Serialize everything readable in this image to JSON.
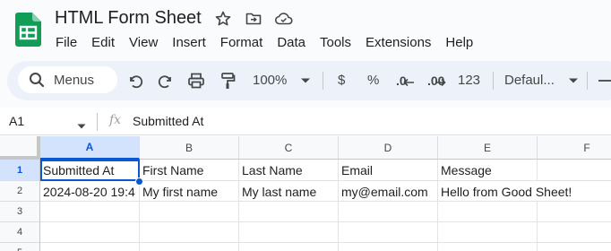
{
  "app": {
    "doc_title": "HTML Form Sheet",
    "menus": [
      "File",
      "Edit",
      "View",
      "Insert",
      "Format",
      "Data",
      "Tools",
      "Extensions",
      "Help"
    ],
    "title_icons": [
      "star-icon",
      "move-to-folder-icon",
      "cloud-status-icon"
    ]
  },
  "toolbar": {
    "menus_search_label": "Menus",
    "zoom": "100%",
    "currency_label": "$",
    "percent_label": "%",
    "decrease_decimal_label": ".0",
    "increase_decimal_label": ".00",
    "number_format_label": "123",
    "font_label": "Defaul...",
    "icons": [
      "search-icon",
      "undo-icon",
      "redo-icon",
      "print-icon",
      "paint-format-icon",
      "caret-down-icon",
      "minus-icon"
    ]
  },
  "formula_bar": {
    "cell_ref": "A1",
    "fx_label": "fx",
    "value": "Submitted At"
  },
  "sheet": {
    "columns": [
      "A",
      "B",
      "C",
      "D",
      "E",
      "F"
    ],
    "rows": [
      "1",
      "2",
      "3",
      "4",
      "5"
    ],
    "cells": [
      [
        "Submitted At",
        "First Name",
        "Last Name",
        "Email",
        "Message",
        ""
      ],
      [
        "2024-08-20 19:4",
        "My first name",
        "My last name",
        "my@email.com",
        "Hello from Good Sheet!",
        ""
      ],
      [
        "",
        "",
        "",
        "",
        "",
        ""
      ],
      [
        "",
        "",
        "",
        "",
        "",
        ""
      ],
      [
        "",
        "",
        "",
        "",
        "",
        ""
      ]
    ],
    "selected_cell": "A1"
  },
  "colors": {
    "accent": "#0b57d0",
    "logo_green": "#0f9d58",
    "toolbar_bg": "#edf2fa",
    "selection_bg": "#d3e3fd"
  }
}
